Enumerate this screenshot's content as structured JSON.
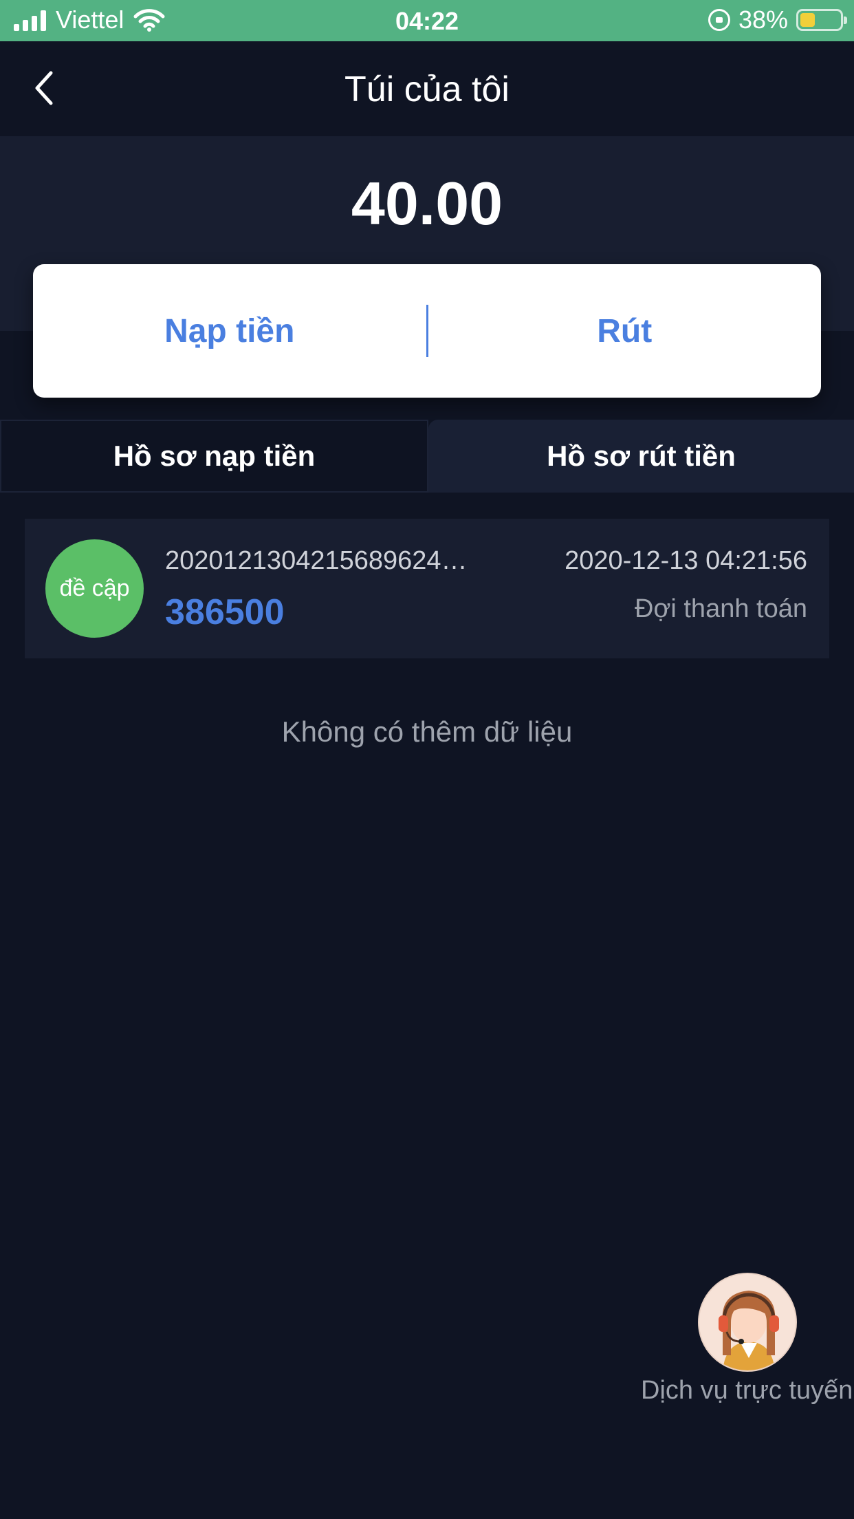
{
  "status_bar": {
    "carrier": "Viettel",
    "time": "04:22",
    "battery": "38%",
    "battery_level": 0.38,
    "icons": [
      "signal-icon",
      "wifi-icon",
      "orientation-lock-icon",
      "battery-icon"
    ]
  },
  "header": {
    "title": "Túi của tôi",
    "back_icon": "chevron-left-icon"
  },
  "wallet": {
    "balance": "40.00",
    "deposit_label": "Nạp tiền",
    "withdraw_label": "Rút"
  },
  "tabs": [
    {
      "label": "Hồ sơ nạp tiền",
      "active": true
    },
    {
      "label": "Hồ sơ rút tiền",
      "active": false
    }
  ],
  "records": [
    {
      "badge": "đề cập",
      "id": "2020121304215689624…",
      "amount": "386500",
      "datetime": "2020-12-13 04:21:56",
      "status": "Đợi thanh toán"
    }
  ],
  "empty_note": "Không có thêm dữ liệu",
  "support": {
    "label": "Dịch vụ trực tuyến",
    "icon": "customer-service-avatar-icon"
  },
  "colors": {
    "status_bar": "#53b283",
    "background": "#0f1423",
    "accent": "#4a7fe0",
    "badge": "#5bbf67"
  }
}
